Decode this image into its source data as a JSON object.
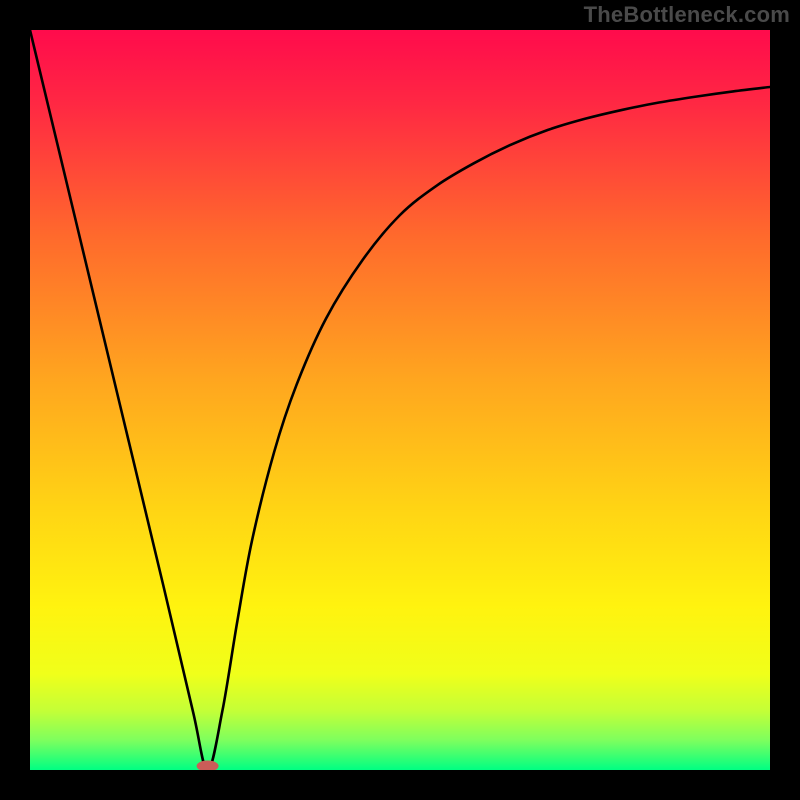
{
  "watermark": "TheBottleneck.com",
  "chart_data": {
    "type": "line",
    "title": "",
    "xlabel": "",
    "ylabel": "",
    "xlim": [
      0,
      100
    ],
    "ylim": [
      0,
      100
    ],
    "grid": false,
    "legend": false,
    "minimum_marker": {
      "x": 24,
      "y": 0
    },
    "series": [
      {
        "name": "curve",
        "x": [
          0,
          6,
          12,
          18,
          22,
          24,
          26,
          28,
          30,
          33,
          36,
          40,
          45,
          50,
          55,
          60,
          65,
          70,
          75,
          80,
          85,
          90,
          95,
          100
        ],
        "values": [
          100,
          75,
          50,
          25,
          8,
          0,
          8,
          20,
          31,
          43,
          52,
          61,
          69,
          75,
          79,
          82,
          84.5,
          86.5,
          88,
          89.2,
          90.2,
          91,
          91.7,
          92.3
        ]
      }
    ],
    "background_gradient": {
      "stops": [
        {
          "offset": 0.0,
          "color": "#ff0b4c"
        },
        {
          "offset": 0.1,
          "color": "#ff2843"
        },
        {
          "offset": 0.28,
          "color": "#ff6a2c"
        },
        {
          "offset": 0.47,
          "color": "#ffa51f"
        },
        {
          "offset": 0.65,
          "color": "#ffd514"
        },
        {
          "offset": 0.78,
          "color": "#fff30f"
        },
        {
          "offset": 0.87,
          "color": "#f0ff1a"
        },
        {
          "offset": 0.92,
          "color": "#c4ff37"
        },
        {
          "offset": 0.96,
          "color": "#7dff5e"
        },
        {
          "offset": 1.0,
          "color": "#00ff83"
        }
      ]
    },
    "marker_color": "#cb5d58",
    "curve_color": "#000000"
  }
}
